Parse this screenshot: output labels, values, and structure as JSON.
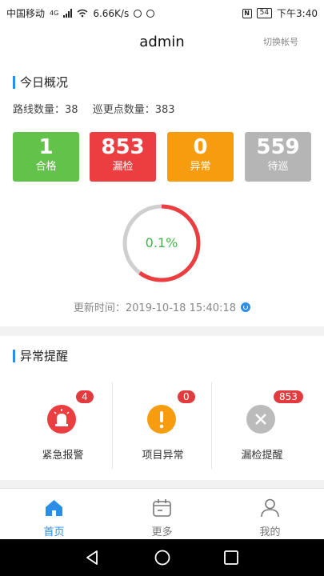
{
  "status_bar": {
    "carrier": "中国移动",
    "network": "4G",
    "speed": "6.66K/s",
    "battery": "54",
    "time": "下午3:40"
  },
  "header": {
    "title": "admin",
    "switch_account": "切换帐号"
  },
  "overview": {
    "title": "今日概况",
    "route_count": "路线数量：38",
    "point_count": "巡更点数量：383",
    "boxes": [
      {
        "value": "1",
        "label": "合格",
        "color": "#62c24a"
      },
      {
        "value": "853",
        "label": "漏检",
        "color": "#ec3d40"
      },
      {
        "value": "0",
        "label": "异常",
        "color": "#f79c0e"
      },
      {
        "value": "559",
        "label": "待巡",
        "color": "#b5b5b5"
      }
    ],
    "ring_percent": "0.1%",
    "ring_missed_fraction": 0.6,
    "update_label": "更新时间：",
    "update_time": "2019-10-18 15:40:18"
  },
  "alerts": {
    "title": "异常提醒",
    "items": [
      {
        "label": "紧急报警",
        "badge": "4",
        "icon": "siren-icon",
        "color": "#ec3d40"
      },
      {
        "label": "项目异常",
        "badge": "0",
        "icon": "exclamation-icon",
        "color": "#f79c0e"
      },
      {
        "label": "漏检提醒",
        "badge": "853",
        "icon": "cross-icon",
        "color": "#bbbbbb"
      }
    ]
  },
  "bottom_nav": {
    "items": [
      {
        "label": "首页",
        "icon": "home-icon",
        "active": true
      },
      {
        "label": "更多",
        "icon": "calendar-icon",
        "active": false
      },
      {
        "label": "我的",
        "icon": "user-icon",
        "active": false
      }
    ],
    "active_color": "#2a8ee8",
    "inactive_color": "#777777"
  },
  "colors": {
    "accent": "#2a8ee8",
    "ring_missed": "#ec3d40",
    "ring_track": "#cfcfcf",
    "ring_text": "#46b34a"
  }
}
